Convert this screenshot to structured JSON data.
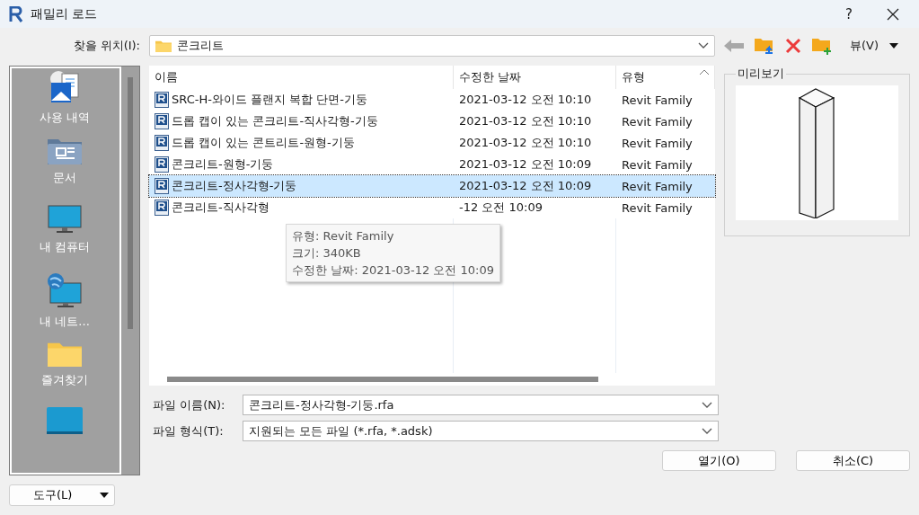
{
  "window": {
    "title": "패밀리 로드",
    "help": "?"
  },
  "location": {
    "label": "찾을 위치(I):",
    "value": "콘크리트"
  },
  "toolbar": {
    "view_label": "뷰(V)"
  },
  "places": [
    {
      "kind": "history",
      "label": "사용 내역"
    },
    {
      "kind": "documents",
      "label": "문서"
    },
    {
      "kind": "computer",
      "label": "내 컴퓨터"
    },
    {
      "kind": "network",
      "label": "내 네트..."
    },
    {
      "kind": "favorites",
      "label": "즐겨찾기"
    },
    {
      "kind": "desktop"
    }
  ],
  "file_list": {
    "columns": [
      "이름",
      "수정한 날짜",
      "유형"
    ],
    "rows": [
      {
        "name": "SRC-H-와이드 플랜지 복합 단면-기둥",
        "date": "2021-03-12 오전 10:10",
        "type": "Revit Family",
        "selected": false
      },
      {
        "name": "드롭 캡이 있는 콘크리트-직사각형-기둥",
        "date": "2021-03-12 오전 10:10",
        "type": "Revit Family",
        "selected": false
      },
      {
        "name": "드롭 캡이 있는 콘트리트-원형-기둥",
        "date": "2021-03-12 오전 10:10",
        "type": "Revit Family",
        "selected": false
      },
      {
        "name": "콘크리트-원형-기둥",
        "date": "2021-03-12 오전 10:09",
        "type": "Revit Family",
        "selected": false
      },
      {
        "name": "콘크리트-정사각형-기둥",
        "date": "2021-03-12 오전 10:09",
        "type": "Revit Family",
        "selected": true
      },
      {
        "name": "콘크리트-직사각형",
        "date": "-12 오전 10:09",
        "type": "Revit Family",
        "selected": false
      }
    ]
  },
  "tooltip": {
    "lines": [
      "유형: Revit Family",
      "크기: 340KB",
      "수정한 날짜: 2021-03-12 오전 10:09"
    ]
  },
  "preview": {
    "label": "미리보기"
  },
  "file_name": {
    "label": "파일 이름(N):",
    "value": "콘크리트-정사각형-기둥.rfa"
  },
  "file_type": {
    "label": "파일 형식(T):",
    "value": "지원되는 모든 파일 (*.rfa, *.adsk)"
  },
  "tools_button": "도구(L)",
  "buttons": [
    "열기(O)",
    "취소(C)"
  ]
}
